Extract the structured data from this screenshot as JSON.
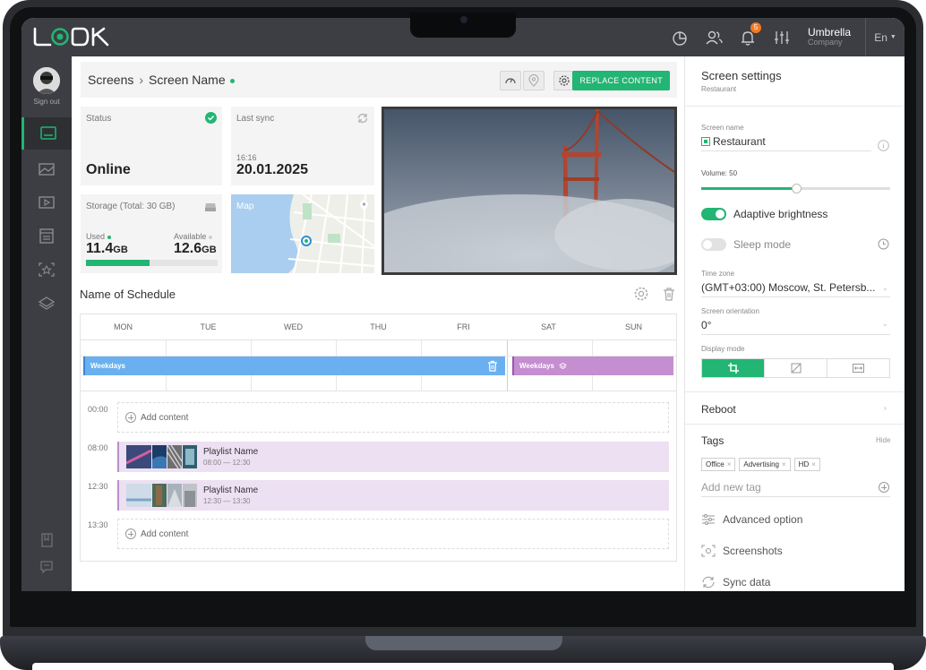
{
  "topbar": {
    "logo_text": "LOOK",
    "notification_count": "5",
    "company_name": "Umbrella",
    "company_label": "Company",
    "language": "En"
  },
  "sidebar": {
    "signout_label": "Sign out"
  },
  "breadcrumb": {
    "root": "Screens",
    "current": "Screen Name",
    "replace_label": "REPLACE CONTENT"
  },
  "status_card": {
    "label": "Status",
    "value": "Online"
  },
  "sync_card": {
    "label": "Last sync",
    "time": "16:16",
    "date": "20.01.2025"
  },
  "storage_card": {
    "label": "Storage (Total: 30 GB)",
    "used_label": "Used",
    "used_value": "11.4",
    "used_unit": "GB",
    "available_label": "Available",
    "available_value": "12.6",
    "available_unit": "GB",
    "used_fraction": 0.48
  },
  "map_card": {
    "label": "Map"
  },
  "schedule": {
    "title": "Name of Schedule",
    "days": [
      "MON",
      "TUE",
      "WED",
      "THU",
      "FRI",
      "SAT",
      "SUN"
    ],
    "weekday_bar": "Weekdays",
    "weekend_bar": "Weekdays",
    "slots": [
      {
        "time": "00:00",
        "type": "add",
        "label": "Add content"
      },
      {
        "time": "08:00",
        "type": "playlist",
        "name": "Playlist Name",
        "range": "08:00 — 12:30"
      },
      {
        "time": "12:30",
        "type": "playlist",
        "name": "Playlist Name",
        "range": "12:30 — 13:30"
      },
      {
        "time": "13:30",
        "type": "add",
        "label": "Add content"
      }
    ]
  },
  "settings": {
    "title": "Screen settings",
    "subtitle": "Restaurant",
    "screen_name_label": "Screen name",
    "screen_name_value": "Restaurant",
    "volume_label": "Volume:",
    "volume_value": "50",
    "volume_fraction": 0.5,
    "adaptive_label": "Adaptive brightness",
    "adaptive_on": true,
    "sleep_label": "Sleep mode",
    "sleep_on": false,
    "timezone_label": "Time zone",
    "timezone_value": "(GMT+03:00) Moscow, St. Petersb...",
    "orientation_label": "Screen orientation",
    "orientation_value": "0°",
    "display_label": "Display mode",
    "reboot_label": "Reboot",
    "tags_label": "Tags",
    "tags_hide": "Hide",
    "tags": [
      "Office",
      "Advertising",
      "HD"
    ],
    "add_tag_placeholder": "Add new tag",
    "advanced_label": "Advanced option",
    "screenshots_label": "Screenshots",
    "sync_label": "Sync data"
  },
  "colors": {
    "accent": "#22b573",
    "topbar": "#3c3e43",
    "weekday_bar": "#6ab0f0",
    "weekend_bar": "#c48ed0"
  }
}
